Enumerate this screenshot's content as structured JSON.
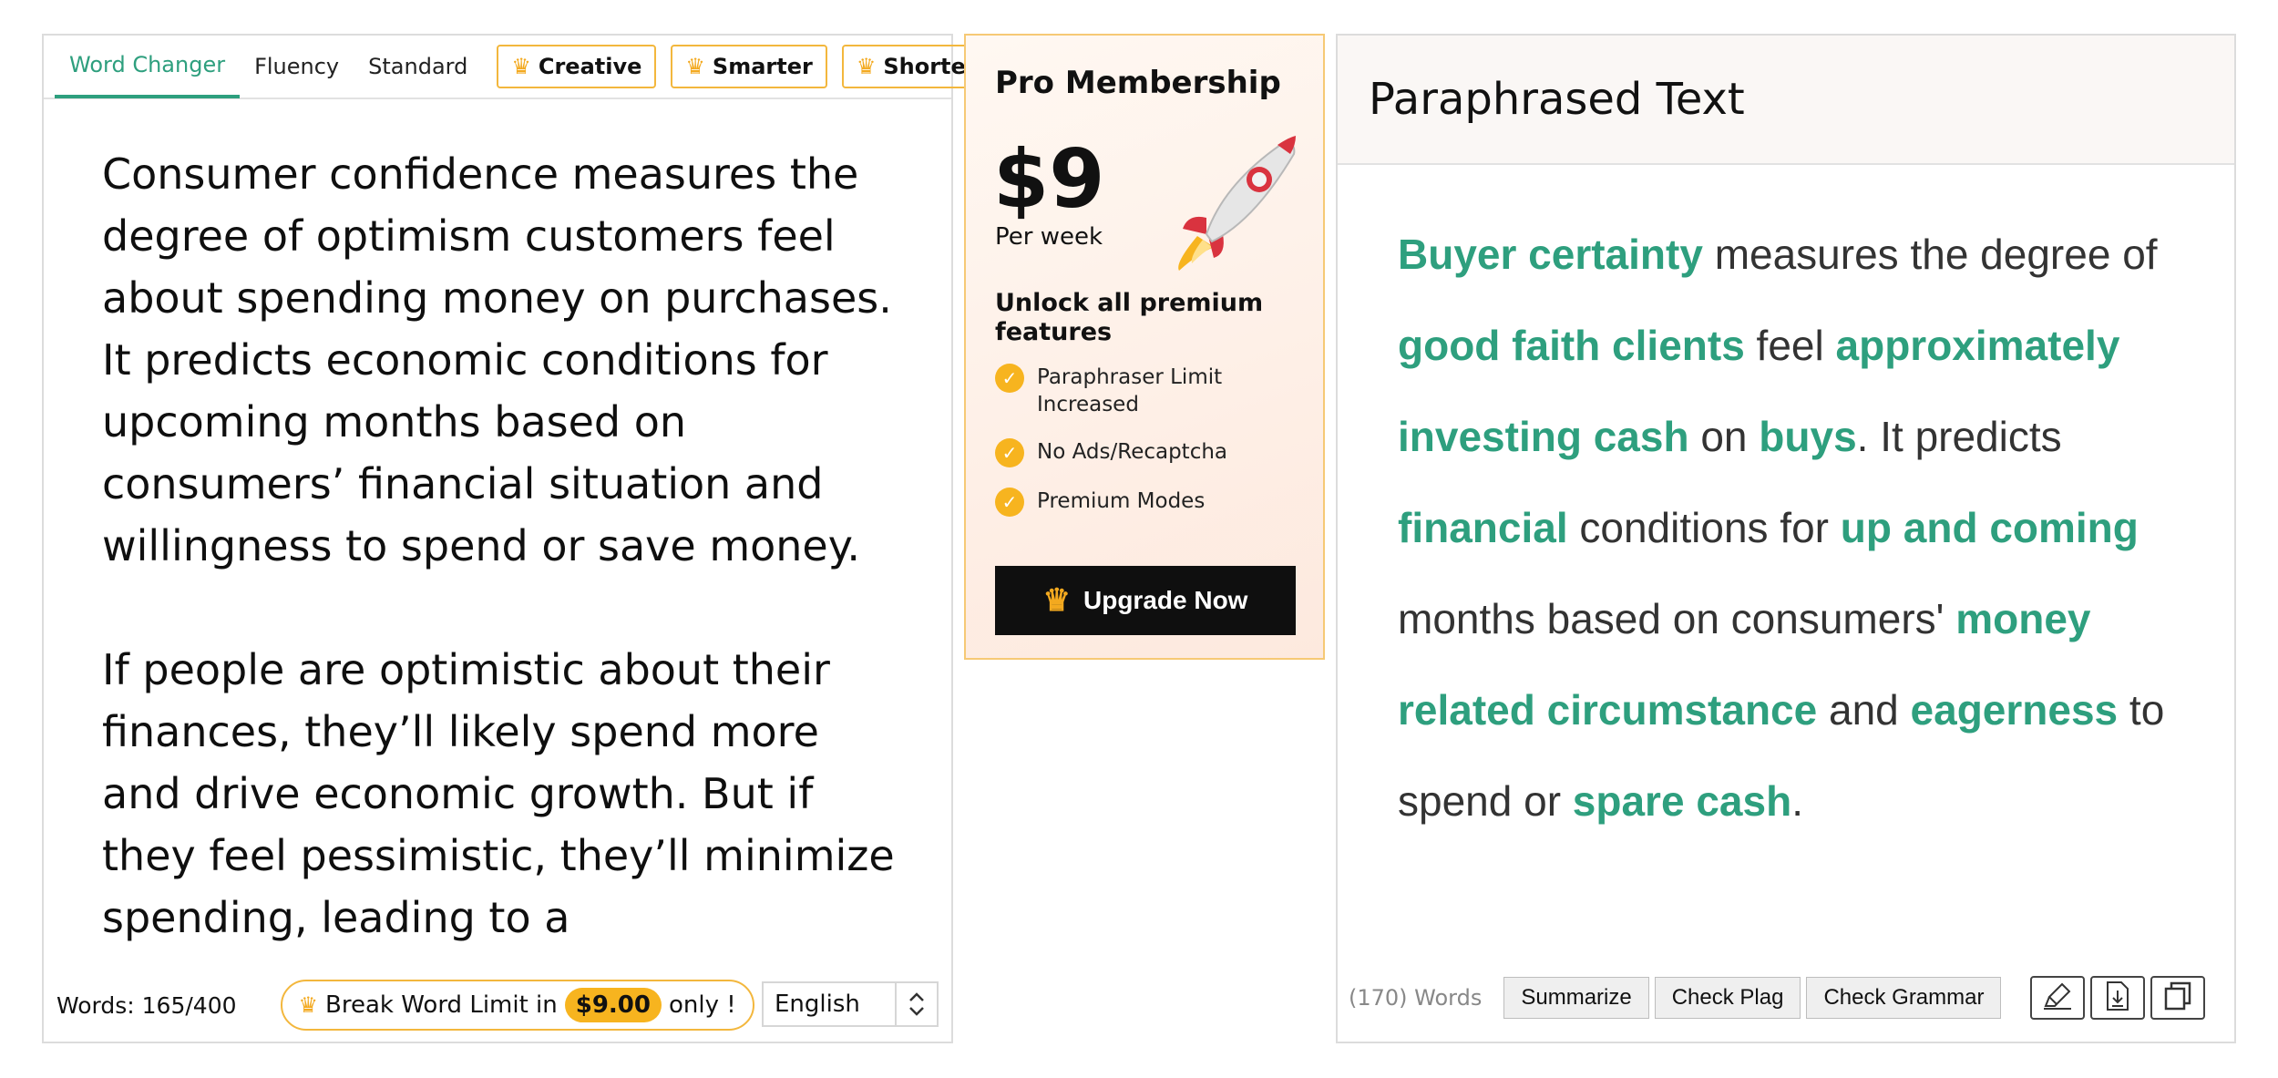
{
  "left": {
    "tabs": [
      {
        "label": "Word Changer",
        "active": true,
        "premium": false
      },
      {
        "label": "Fluency",
        "active": false,
        "premium": false
      },
      {
        "label": "Standard",
        "active": false,
        "premium": false
      },
      {
        "label": "Creative",
        "active": false,
        "premium": true
      },
      {
        "label": "Smarter",
        "active": false,
        "premium": true
      },
      {
        "label": "Shorten",
        "active": false,
        "premium": true
      }
    ],
    "input_paragraphs": [
      "Consumer confidence measures the degree of optimism customers feel about spending money on purchases. It predicts economic conditions for upcoming months based on consumers’ financial situation and willingness to spend or save money.",
      "If people are optimistic about their finances, they’ll likely spend more and drive economic growth. But if they feel pessimistic, they’ll minimize spending, leading to a"
    ],
    "word_count": "Words: 165/400",
    "limit_prefix": "Break Word Limit in",
    "limit_price": "$9.00",
    "limit_suffix": "only !",
    "language": "English"
  },
  "promo": {
    "title": "Pro Membership",
    "price": "$9",
    "period": "Per week",
    "subtitle": "Unlock all premium features",
    "features": [
      "Paraphraser Limit Increased",
      "No Ads/Recaptcha",
      "Premium Modes"
    ],
    "cta": "Upgrade Now"
  },
  "right": {
    "title": "Paraphrased Text",
    "segments": [
      {
        "text": "Buyer certainty",
        "changed": true
      },
      {
        "text": " measures the degree of ",
        "changed": false
      },
      {
        "text": "good faith clients",
        "changed": true
      },
      {
        "text": " feel ",
        "changed": false
      },
      {
        "text": "approximately investing cash",
        "changed": true
      },
      {
        "text": " on ",
        "changed": false
      },
      {
        "text": "buys",
        "changed": true
      },
      {
        "text": ". It predicts ",
        "changed": false
      },
      {
        "text": "financial",
        "changed": true
      },
      {
        "text": " conditions for ",
        "changed": false
      },
      {
        "text": "up and coming",
        "changed": true
      },
      {
        "text": " months based on consumers' ",
        "changed": false
      },
      {
        "text": "money related circumstance",
        "changed": true
      },
      {
        "text": " and ",
        "changed": false
      },
      {
        "text": "eagerness",
        "changed": true
      },
      {
        "text": " to spend or ",
        "changed": false
      },
      {
        "text": "spare cash",
        "changed": true
      },
      {
        "text": ".",
        "changed": false
      }
    ],
    "word_count": "(170) Words",
    "buttons": [
      "Summarize",
      "Check Plag",
      "Check Grammar"
    ],
    "icons": [
      "highlighter-icon",
      "download-icon",
      "copy-icon"
    ]
  },
  "colors": {
    "accent": "#2e9f7e",
    "gold": "#f7b41f"
  }
}
